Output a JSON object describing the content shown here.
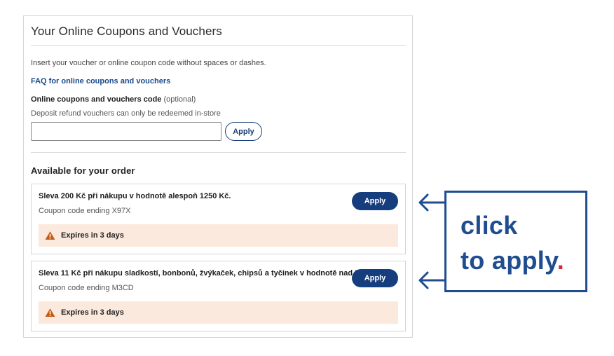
{
  "panel": {
    "title": "Your Online Coupons and Vouchers",
    "instructions": "Insert your voucher or online coupon code without spaces or dashes.",
    "faq_link": "FAQ for online coupons and vouchers",
    "code_field": {
      "label": "Online coupons and vouchers code",
      "optional_note": "(optional)",
      "hint": "Deposit refund vouchers can only be redeemed in-store",
      "value": "",
      "placeholder": ""
    },
    "apply_label": "Apply"
  },
  "available": {
    "title": "Available for your order",
    "coupons": [
      {
        "title": "Sleva 200 Kč při nákupu v hodnotě alespoň 1250 Kč.",
        "code_text": "Coupon code ending X97X",
        "apply_label": "Apply",
        "expiry": "Expires in 3 days"
      },
      {
        "title": "Sleva 11 Kč při nákupu sladkostí, bonbonů, žvýkaček, chipsů a tyčinek v hodnotě nad 55 Kč",
        "code_text": "Coupon code ending M3CD",
        "apply_label": "Apply",
        "expiry": "Expires in 3 days"
      }
    ]
  },
  "callout": {
    "line1": "click",
    "line2": "to apply",
    "dot": "."
  },
  "colors": {
    "brand_blue": "#163e7e",
    "callout_blue": "#1f4d8f",
    "expiry_bg": "#fbe9dd",
    "warning_orange": "#c8580f",
    "accent_red": "#d8273a"
  },
  "icons": {
    "warning": "warning-triangle-icon",
    "arrow": "arrow-left-icon"
  }
}
